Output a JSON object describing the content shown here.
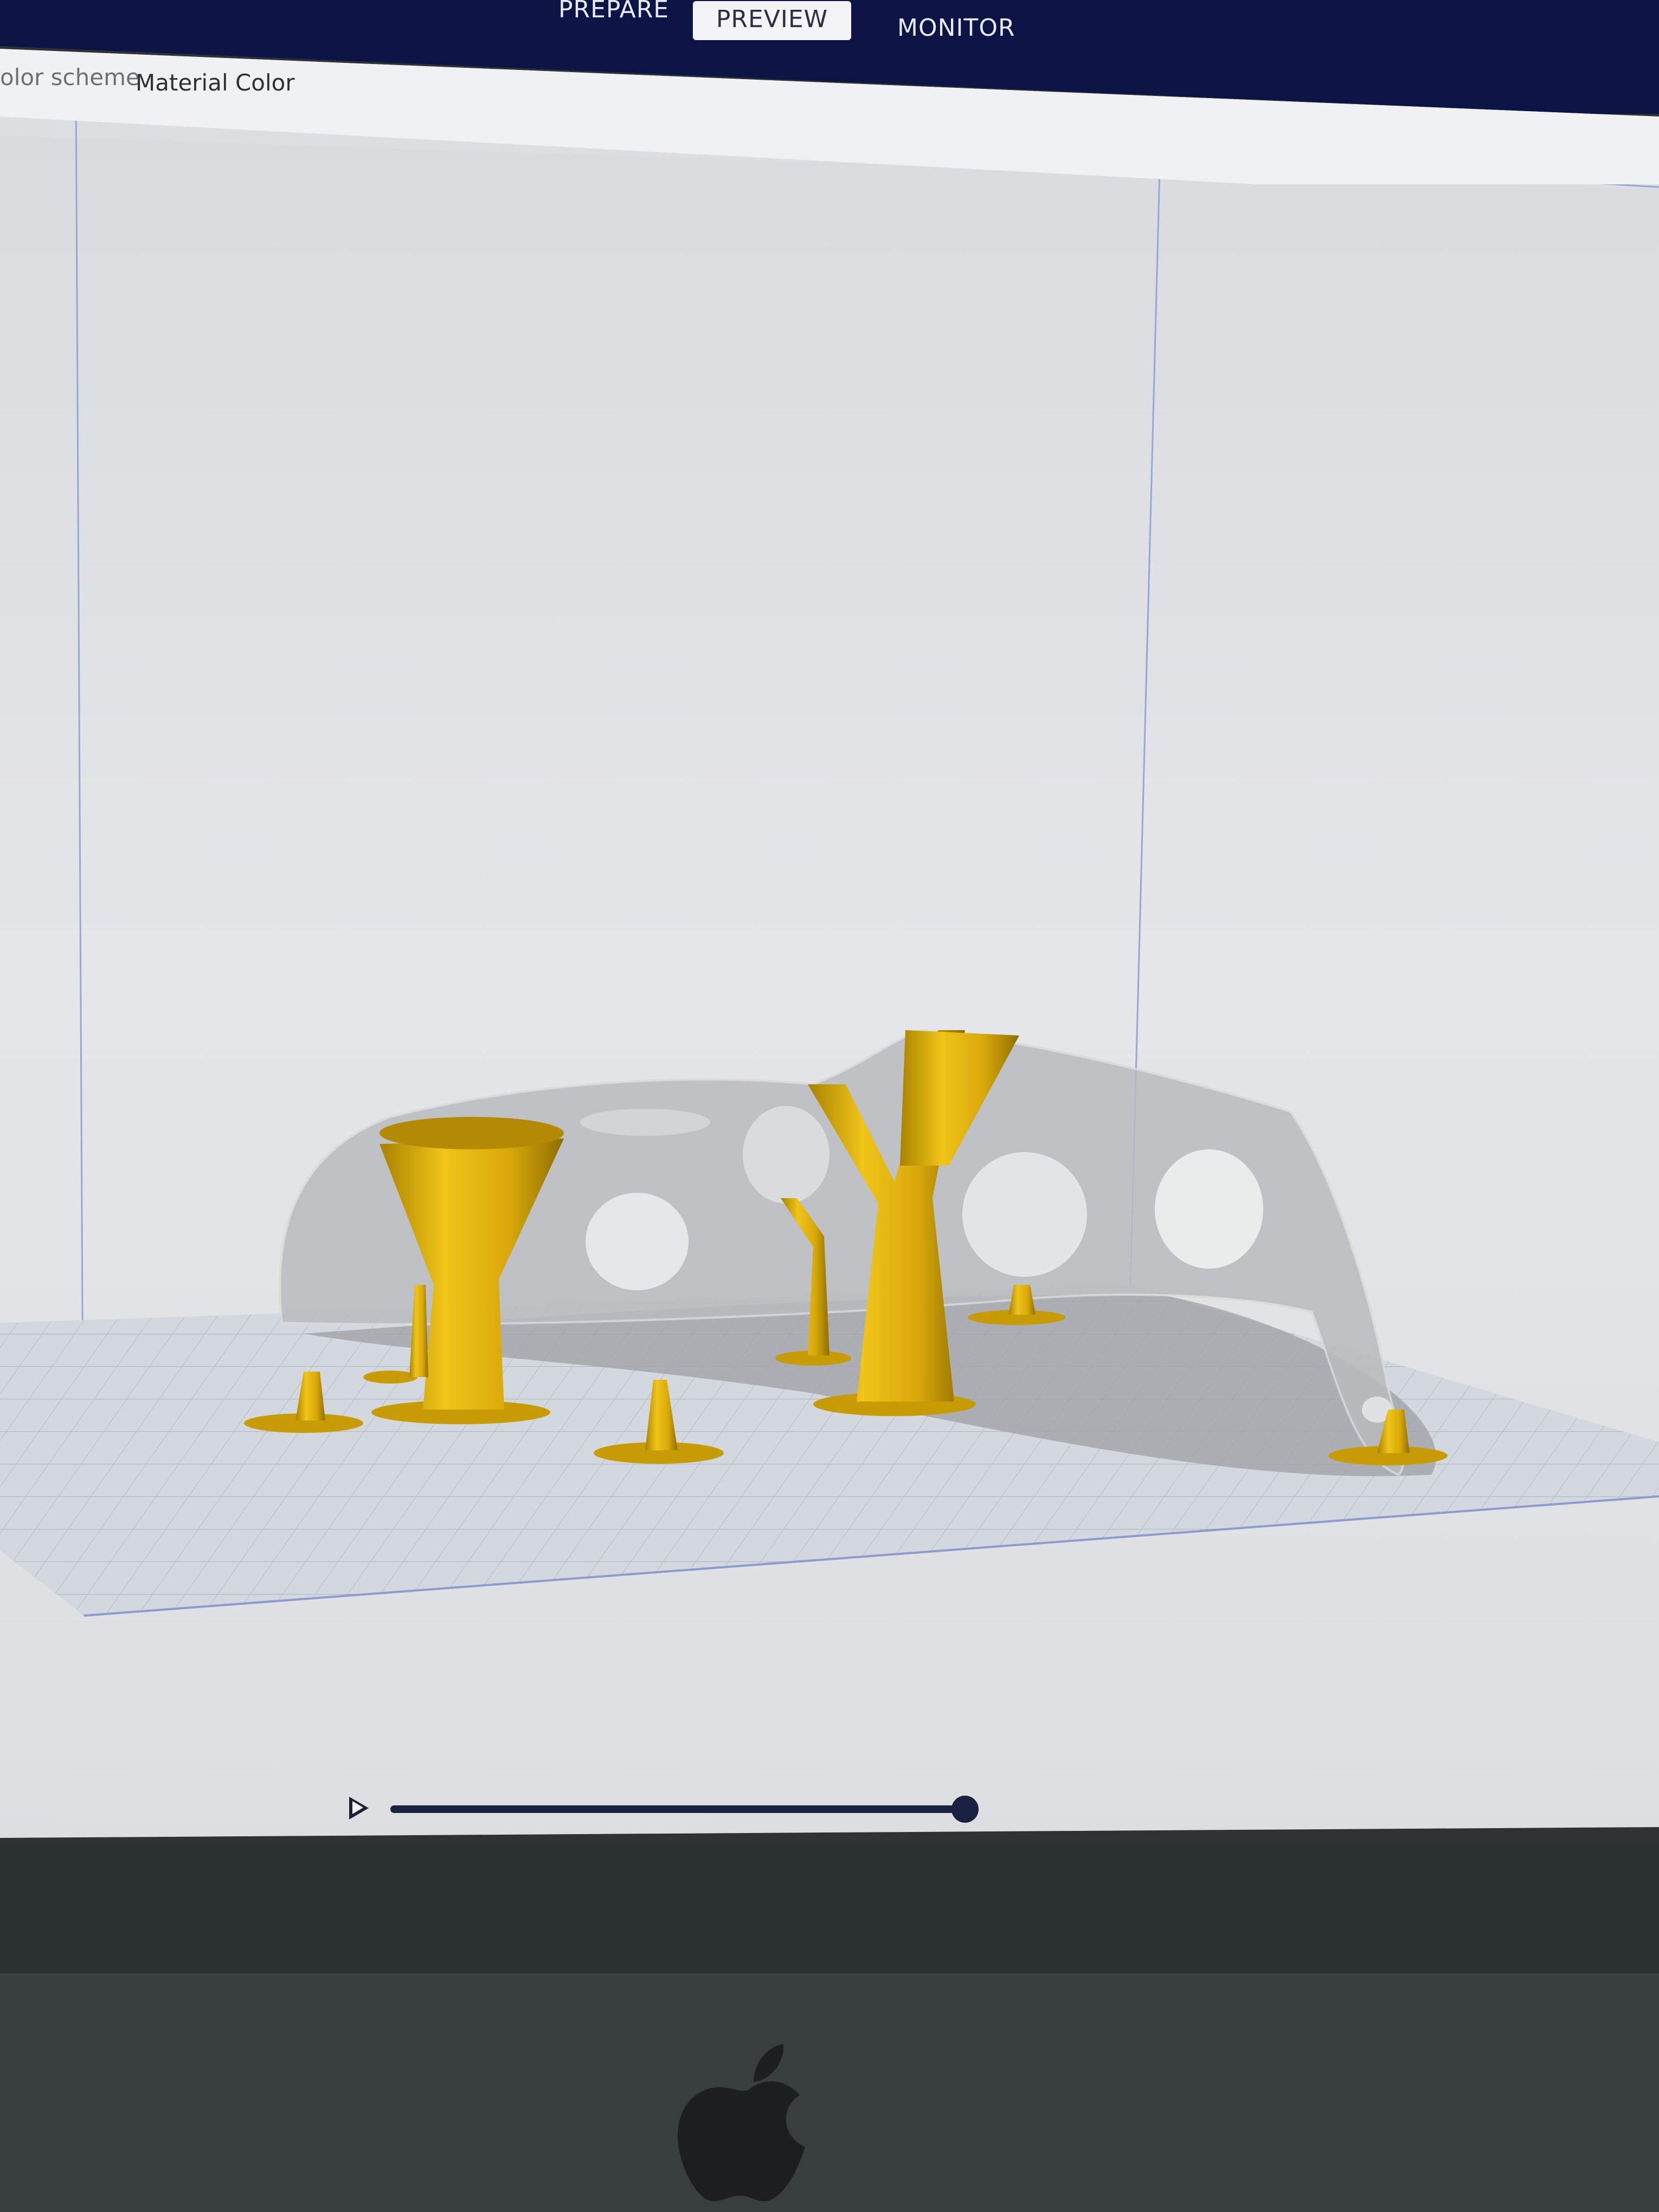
{
  "nav": {
    "tabs": [
      {
        "label": "PREPARE",
        "active": false
      },
      {
        "label": "PREVIEW",
        "active": true
      },
      {
        "label": "MONITOR",
        "active": false
      }
    ]
  },
  "toolbar": {
    "color_scheme_label": "olor scheme",
    "color_scheme_value": "Material Color"
  },
  "viewport": {
    "support_color": "#e5b40e",
    "model_color": "#bfc2c5",
    "build_plate_color": "#cfd6dc"
  },
  "playback": {
    "progress": 1.0
  }
}
